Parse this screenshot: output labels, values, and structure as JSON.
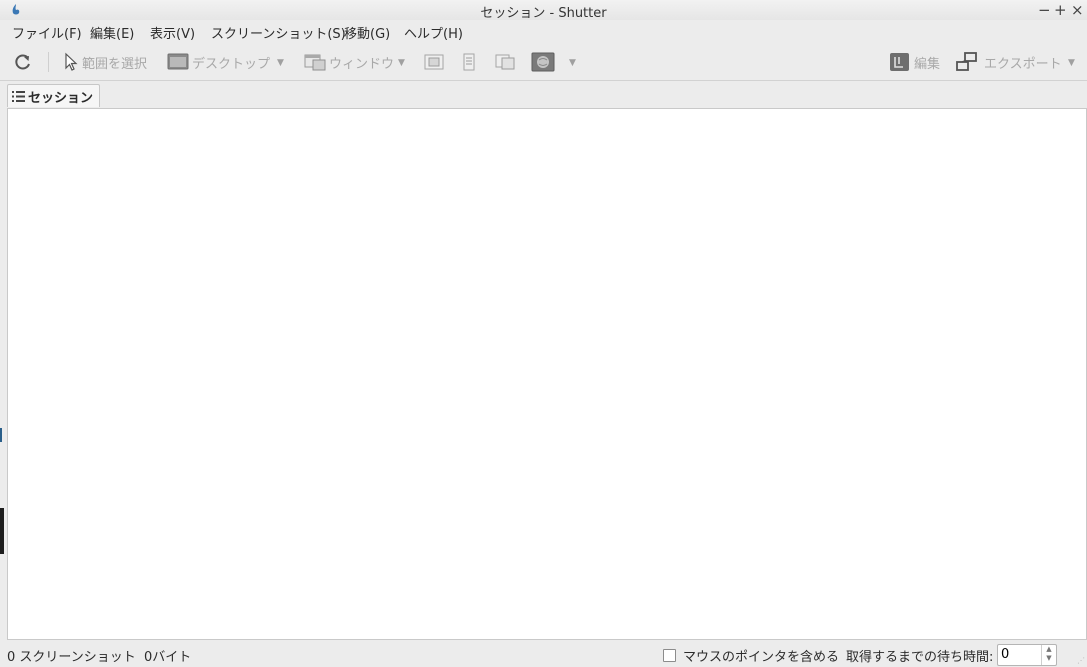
{
  "window": {
    "title": "セッション - Shutter",
    "controls": {
      "minimize": "−",
      "maximize": "+",
      "close": "×"
    }
  },
  "menu": [
    "ファイル(F)",
    "編集(E)",
    "表示(V)",
    "スクリーンショット(S)",
    "移動(G)",
    "ヘルプ(H)"
  ],
  "toolbar": {
    "refresh_icon": "refresh-icon",
    "select_label": "範囲を選択",
    "desktop_label": "デスクトップ",
    "window_label": "ウィンドウ",
    "edit_label": "編集",
    "export_label": "エクスポート"
  },
  "tabs": [
    {
      "label": "セッション",
      "icon": "list-icon"
    }
  ],
  "status": {
    "summary": "0 スクリーンショット  0バイト",
    "pointer_label": "マウスのポインタを含める",
    "pointer_checked": false,
    "delay_label": "取得するまでの待ち時間:",
    "delay_value": "0"
  }
}
